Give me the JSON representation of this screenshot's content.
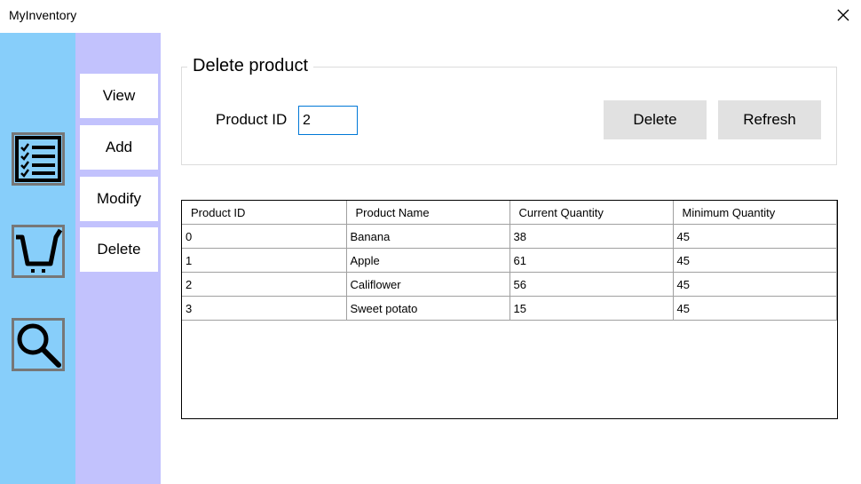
{
  "window": {
    "title": "MyInventory"
  },
  "menu": {
    "view_label": "View",
    "add_label": "Add",
    "modify_label": "Modify",
    "delete_label": "Delete"
  },
  "icons": [
    "checklist-icon",
    "cart-icon",
    "search-icon"
  ],
  "delete_form": {
    "group_title": "Delete product",
    "product_id_label": "Product ID",
    "product_id_value": "2",
    "delete_button": "Delete",
    "refresh_button": "Refresh"
  },
  "table": {
    "columns": [
      "Product ID",
      "Product Name",
      "Current Quantity",
      "Minimum Quantity"
    ],
    "rows": [
      [
        "0",
        "Banana",
        "38",
        "45"
      ],
      [
        "1",
        "Apple",
        "61",
        "45"
      ],
      [
        "2",
        "Califlower",
        "56",
        "45"
      ],
      [
        "3",
        "Sweet potato",
        "15",
        "45"
      ]
    ]
  },
  "colors": {
    "icon_bar": "#87cefa",
    "menu_bar": "#c2c2fd",
    "button_bg": "#e1e1e1",
    "input_border": "#0078d7"
  }
}
